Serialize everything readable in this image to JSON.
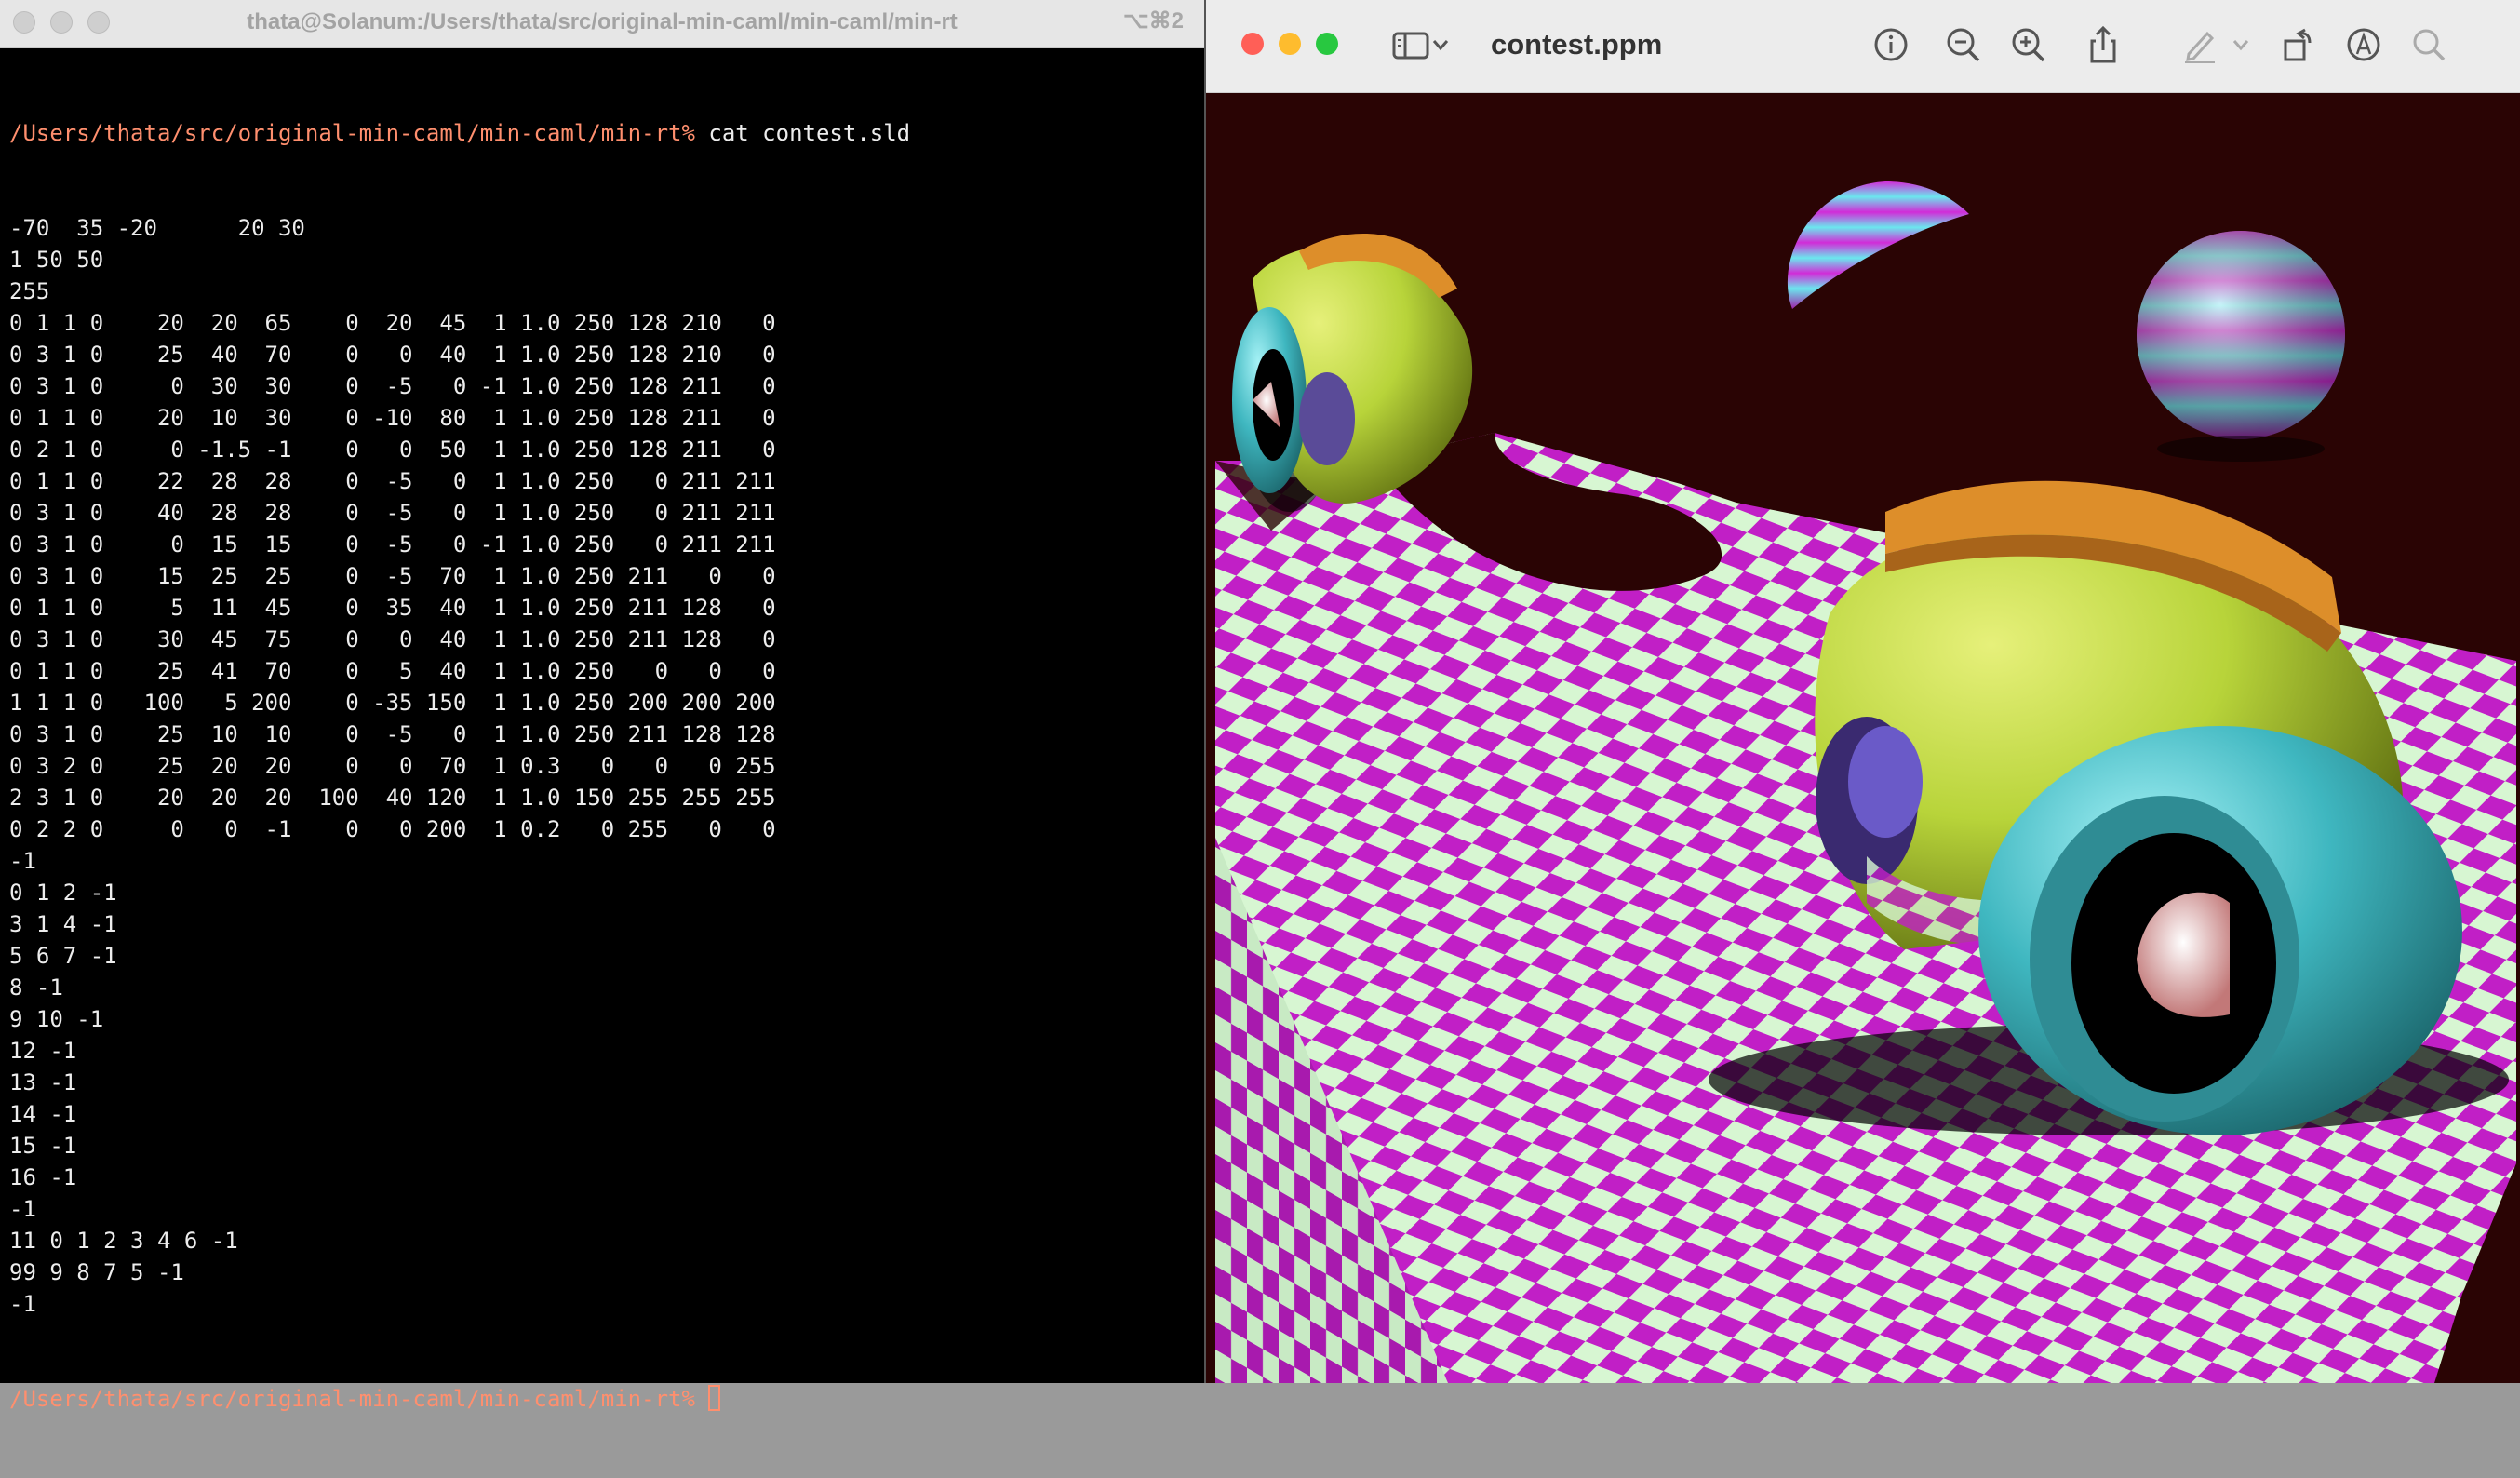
{
  "terminal": {
    "title": "thata@Solanum:/Users/thata/src/original-min-caml/min-caml/min-rt",
    "shortcut": "⌥⌘2",
    "prompt": "/Users/thata/src/original-min-caml/min-caml/min-rt%",
    "command": " cat contest.sld",
    "output_lines": [
      "-70  35 -20      20 30",
      "1 50 50",
      "255",
      "0 1 1 0    20  20  65    0  20  45  1 1.0 250 128 210   0",
      "0 3 1 0    25  40  70    0   0  40  1 1.0 250 128 210   0",
      "0 3 1 0     0  30  30    0  -5   0 -1 1.0 250 128 211   0",
      "0 1 1 0    20  10  30    0 -10  80  1 1.0 250 128 211   0",
      "0 2 1 0     0 -1.5 -1    0   0  50  1 1.0 250 128 211   0",
      "0 1 1 0    22  28  28    0  -5   0  1 1.0 250   0 211 211",
      "0 3 1 0    40  28  28    0  -5   0  1 1.0 250   0 211 211",
      "0 3 1 0     0  15  15    0  -5   0 -1 1.0 250   0 211 211",
      "0 3 1 0    15  25  25    0  -5  70  1 1.0 250 211   0   0",
      "0 1 1 0     5  11  45    0  35  40  1 1.0 250 211 128   0",
      "0 3 1 0    30  45  75    0   0  40  1 1.0 250 211 128   0",
      "0 1 1 0    25  41  70    0   5  40  1 1.0 250   0   0   0",
      "1 1 1 0   100   5 200    0 -35 150  1 1.0 250 200 200 200",
      "0 3 1 0    25  10  10    0  -5   0  1 1.0 250 211 128 128",
      "0 3 2 0    25  20  20    0   0  70  1 0.3   0   0   0 255",
      "2 3 1 0    20  20  20  100  40 120  1 1.0 150 255 255 255",
      "0 2 2 0     0   0  -1    0   0 200  1 0.2   0 255   0   0",
      "-1",
      "0 1 2 -1",
      "3 1 4 -1",
      "5 6 7 -1",
      "8 -1",
      "9 10 -1",
      "12 -1",
      "13 -1",
      "14 -1",
      "15 -1",
      "16 -1",
      "-1",
      "11 0 1 2 3 4 6 -1",
      "99 9 8 7 5 -1",
      "-1"
    ]
  },
  "preview": {
    "title": "contest.ppm",
    "toolbar_icons": [
      "sidebar-icon",
      "chevron-down-icon",
      "info-icon",
      "zoom-out-icon",
      "zoom-in-icon",
      "share-icon",
      "markup-pen-icon",
      "chevron-down-icon",
      "rotate-icon",
      "annotate-icon",
      "search-icon"
    ]
  },
  "colors": {
    "close": "#ff5f57",
    "minimize": "#febc2e",
    "zoom": "#28c840",
    "prompt": "#ff8f6e",
    "checker_magenta": "#c11fc6",
    "checker_mint": "#d7f6d2",
    "background_render": "#2a0404",
    "car_body": "#b8d43a",
    "car_fin": "#dd8e2a",
    "wheel": "#3fb7c0"
  }
}
